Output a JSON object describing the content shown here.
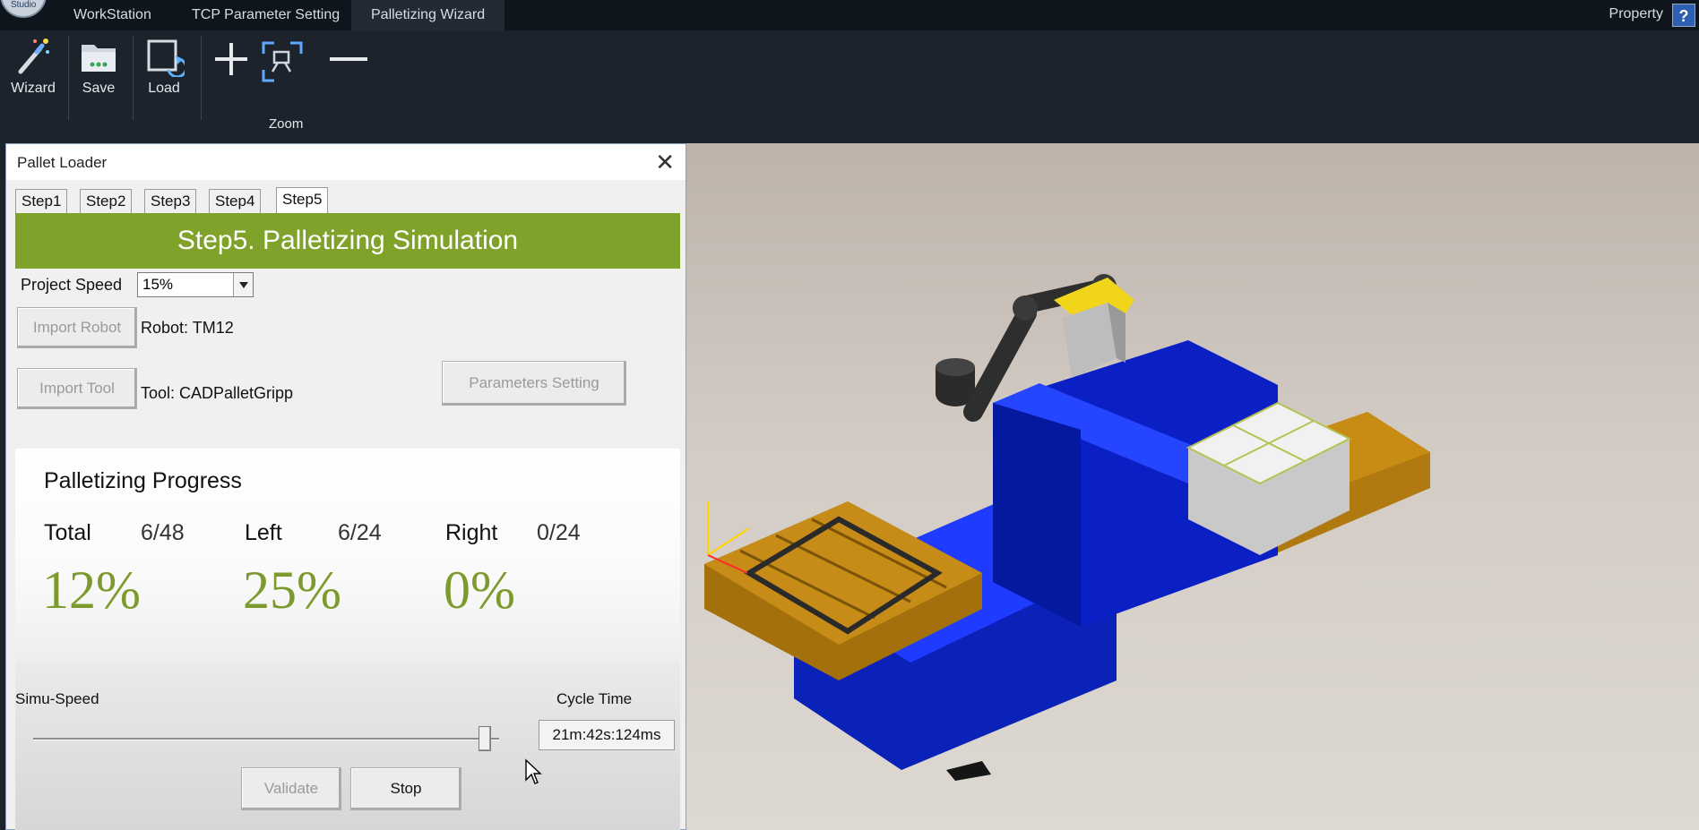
{
  "menubar": {
    "logo_text": "Studio",
    "tabs": [
      {
        "label": "WorkStation"
      },
      {
        "label": "TCP Parameter Setting"
      },
      {
        "label": "Palletizing Wizard"
      }
    ],
    "property_label": "Property",
    "help_glyph": "?"
  },
  "toolbar": {
    "wizard_label": "Wizard",
    "save_label": "Save",
    "load_label": "Load",
    "zoom_group_label": "Zoom",
    "icons": [
      "magic-wand-icon",
      "folder-save-icon",
      "load-icon",
      "zoom-in-icon",
      "zoom-fit-icon",
      "zoom-out-icon"
    ]
  },
  "pallet_window": {
    "title": "Pallet Loader",
    "close_glyph": "✕",
    "tabs": [
      "Step1",
      "Step2",
      "Step3",
      "Step4",
      "Step5"
    ],
    "active_tab": "Step5",
    "banner": "Step5. Palletizing Simulation",
    "project_speed_label": "Project Speed",
    "project_speed_value": "15%",
    "import_robot_label": "Import Robot",
    "robot_info": "Robot: TM12",
    "import_tool_label": "Import Tool",
    "tool_info": "Tool:  CADPalletGripp",
    "parameters_setting_label": "Parameters Setting",
    "progress": {
      "title": "Palletizing Progress",
      "total_label": "Total",
      "total_count": "6/48",
      "total_pct": "12%",
      "left_label": "Left",
      "left_count": "6/24",
      "left_pct": "25%",
      "right_label": "Right",
      "right_count": "0/24",
      "right_pct": "0%"
    },
    "simu_speed_label": "Simu-Speed",
    "simu_speed_level": 0.97,
    "cycle_time_label": "Cycle Time",
    "cycle_time_value": "21m:42s:124ms",
    "validate_label": "Validate",
    "stop_label": "Stop"
  },
  "colors": {
    "accent_green": "#7fa32a",
    "percent_green": "#7d9a2e",
    "menubar_bg": "#0f151c",
    "ribbon_bg": "#1c232c"
  }
}
